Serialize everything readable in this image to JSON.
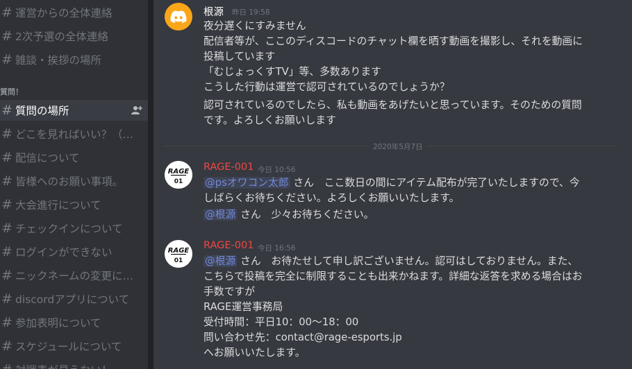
{
  "sidebar": {
    "channels_top": [
      {
        "label": "運営からの全体連絡"
      },
      {
        "label": "2次予選の全体連絡"
      },
      {
        "label": "雑談・挨拶の場所"
      }
    ],
    "category": "質問！",
    "channels": [
      {
        "label": "質問の場所",
        "active": true
      },
      {
        "label": "どこを見ればいい？（…"
      },
      {
        "label": "配信について"
      },
      {
        "label": "皆様へのお願い事項。"
      },
      {
        "label": "大会進行について"
      },
      {
        "label": "チェックインについて"
      },
      {
        "label": "ログインができない"
      },
      {
        "label": "ニックネームの変更に…"
      },
      {
        "label": "discordアプリについて"
      },
      {
        "label": "参加表明について"
      },
      {
        "label": "スケジュールについて"
      },
      {
        "label": "対戦表が見えない！"
      }
    ]
  },
  "messages": [
    {
      "author": "根源",
      "author_color": "#ffffff",
      "timestamp": "昨日 19:58",
      "avatar": "discord-logo-icon",
      "lines": [
        "夜分遅くにすみません",
        "配信者等が、ここのディスコードのチャット欄を晒す動画を撮影し、それを動画に",
        "投稿しています",
        "「むじょっくすTV」等、多数あります",
        "こうした行動は運営で認可されているのでしょうか？"
      ],
      "lines2": [
        "認可されているのでしたら、私も動画をあげたいと思っています。そのための質問",
        "です。よろしくお願いします"
      ]
    },
    {
      "author": "RAGE-001",
      "author_color": "#f04747",
      "timestamp": "今日 10:56",
      "avatar": "rage-logo-icon",
      "mention1": "@psオワコン太郎",
      "text1a": " さん　ここ数日の間にアイテム配布が完了いたしますので、今",
      "text1b": "しばらくお待ちください。よろしくお願いいたします。",
      "mention2": "@根源",
      "text2": " さん　少々お待ちください。"
    },
    {
      "author": "RAGE-001",
      "author_color": "#f04747",
      "timestamp": "今日 16:56",
      "avatar": "rage-logo-icon",
      "mention": "@根源",
      "text_a": " さん　お待たせして申し訳ございません。認可はしておりません。また、",
      "lines": [
        "こちらで投稿を完全に制限することも出来かねます。詳細な返答を求める場合はお",
        "手数ですが",
        "RAGE運営事務局",
        "受付時間：平日10：00〜18：00",
        "問い合わせ先：contact@rage-esports.jp",
        "へお願いいたします。"
      ]
    }
  ],
  "divider": "2020年5月7日",
  "rage_logo": {
    "word": "RAGE",
    "num": "01"
  }
}
